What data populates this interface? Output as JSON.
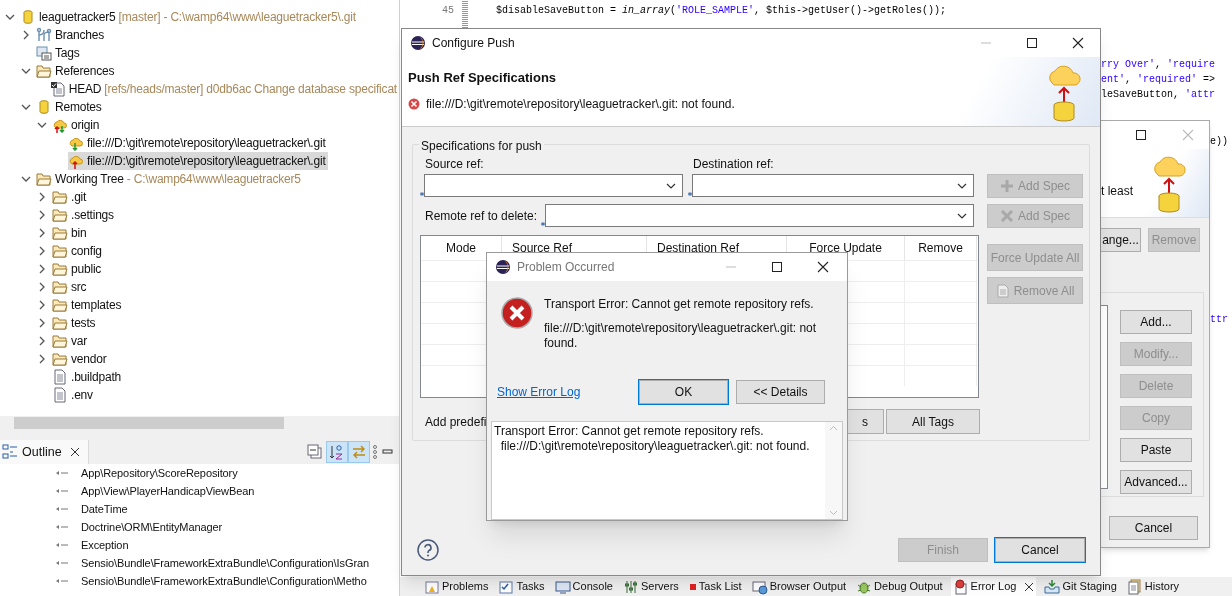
{
  "repositories": {
    "tree": [
      {
        "kind": "repo",
        "label": "leaguetracker5",
        "detail": "[master] - C:\\wamp64\\www\\leaguetracker5\\.git",
        "expanded": true,
        "selected": false,
        "children": [
          {
            "kind": "branches",
            "label": "Branches",
            "expanded": false,
            "selected": false
          },
          {
            "kind": "tags",
            "label": "Tags",
            "selected": false
          },
          {
            "kind": "folder",
            "label": "References",
            "expanded": true,
            "selected": false,
            "children": [
              {
                "kind": "ref",
                "label": "HEAD",
                "detail": "[refs/heads/master] d0db6ac Change database specificat",
                "selected": false
              }
            ]
          },
          {
            "kind": "repo",
            "label": "Remotes",
            "expanded": true,
            "selected": false,
            "children": [
              {
                "kind": "origin",
                "label": "origin",
                "expanded": true,
                "selected": false,
                "children": [
                  {
                    "kind": "fetch",
                    "label": "file:///D:\\git\\remote\\repository\\leaguetracker\\.git",
                    "selected": false
                  },
                  {
                    "kind": "push",
                    "label": "file:///D:\\git\\remote\\repository\\leaguetracker\\.git",
                    "selected": true
                  }
                ]
              }
            ]
          },
          {
            "kind": "folder",
            "label": "Working Tree",
            "detail": "- C:\\wamp64\\www\\leaguetracker5",
            "expanded": true,
            "selected": false,
            "children": [
              {
                "kind": "folder",
                "label": ".git",
                "expanded": false,
                "selected": false
              },
              {
                "kind": "folder",
                "label": ".settings",
                "expanded": false,
                "selected": false
              },
              {
                "kind": "folder",
                "label": "bin",
                "expanded": false,
                "selected": false
              },
              {
                "kind": "folder",
                "label": "config",
                "expanded": false,
                "selected": false
              },
              {
                "kind": "folder",
                "label": "public",
                "expanded": false,
                "selected": false
              },
              {
                "kind": "folder",
                "label": "src",
                "expanded": false,
                "selected": false
              },
              {
                "kind": "folder",
                "label": "templates",
                "expanded": false,
                "selected": false
              },
              {
                "kind": "folder",
                "label": "tests",
                "expanded": false,
                "selected": false
              },
              {
                "kind": "folder",
                "label": "var",
                "expanded": false,
                "selected": false
              },
              {
                "kind": "folder",
                "label": "vendor",
                "expanded": false,
                "selected": false
              },
              {
                "kind": "file",
                "label": ".buildpath",
                "selected": false
              },
              {
                "kind": "file",
                "label": ".env",
                "selected": false
              }
            ]
          }
        ]
      }
    ]
  },
  "outline": {
    "title": "Outline",
    "toolbar": [
      {
        "kind": "collapse",
        "active": false
      },
      {
        "kind": "sort",
        "active": true
      },
      {
        "kind": "link",
        "active": true
      }
    ],
    "items": [
      "App\\Repository\\ScoreRepository",
      "App\\View\\PlayerHandicapViewBean",
      "DateTime",
      "Doctrine\\ORM\\EntityManager",
      "Exception",
      "Sensio\\Bundle\\FrameworkExtraBundle\\Configuration\\IsGran",
      "Sensio\\Bundle\\FrameworkExtraBundle\\Configuration\\Metho"
    ]
  },
  "editor": {
    "lines": [
      {
        "number": "45",
        "segments": [
          {
            "kind": "plain",
            "text": "$disableSaveButton = "
          },
          {
            "kind": "func",
            "text": "in_array"
          },
          {
            "kind": "plain",
            "text": "("
          },
          {
            "kind": "string",
            "text": "'ROLE_SAMPLE'"
          },
          {
            "kind": "plain",
            "text": ", $this->getUser()->getRoles());"
          }
        ]
      }
    ],
    "fragments": [
      [
        {
          "kind": "string",
          "text": "rry Over'"
        },
        {
          "kind": "plain",
          "text": ", "
        },
        {
          "kind": "string",
          "text": "'require"
        }
      ],
      [
        {
          "kind": "string",
          "text": "ent'"
        },
        {
          "kind": "plain",
          "text": ", "
        },
        {
          "kind": "string",
          "text": "'required'"
        },
        {
          "kind": "plain",
          "text": " =>"
        }
      ],
      [
        {
          "kind": "plain",
          "text": "leSaveButton, "
        },
        {
          "kind": "string",
          "text": "'attr"
        }
      ],
      [
        {
          "kind": "plain",
          "text": "e))"
        }
      ],
      [
        {
          "kind": "string",
          "text": "ttr"
        }
      ]
    ]
  },
  "bottom_tabs": [
    {
      "kind": "problems",
      "label": "Problems",
      "selected": false
    },
    {
      "kind": "tasks",
      "label": "Tasks",
      "selected": false
    },
    {
      "kind": "console",
      "label": "Console",
      "selected": false
    },
    {
      "kind": "servers",
      "label": "Servers",
      "selected": false
    },
    {
      "kind": "tasklist",
      "label": "Task List",
      "selected": false
    },
    {
      "kind": "browser",
      "label": "Browser Output",
      "selected": false
    },
    {
      "kind": "debug",
      "label": "Debug Output",
      "selected": false
    },
    {
      "kind": "errorlog",
      "label": "Error Log",
      "selected": true
    },
    {
      "kind": "staging",
      "label": "Git Staging",
      "selected": false
    },
    {
      "kind": "history",
      "label": "History",
      "selected": false
    }
  ],
  "back_dialog": {
    "header_text": "t least",
    "top_buttons": [
      {
        "label": "ange...",
        "disabled": false
      },
      {
        "label": "Remove",
        "disabled": true
      }
    ],
    "side_buttons": [
      {
        "label": "Add...",
        "disabled": false
      },
      {
        "label": "Modify...",
        "disabled": true
      },
      {
        "label": "Delete",
        "disabled": true
      },
      {
        "label": "Copy",
        "disabled": true
      },
      {
        "label": "Paste",
        "disabled": false
      },
      {
        "label": "Advanced...",
        "disabled": false
      }
    ],
    "cancel": "Cancel"
  },
  "configure_push": {
    "title": "Configure Push",
    "header_title": "Push Ref Specifications",
    "error_message": "file:///D:\\git\\remote\\repository\\leaguetracker\\.git: not found.",
    "group_title": "Specifications for push",
    "source_label": "Source ref:",
    "destination_label": "Destination ref:",
    "delete_label": "Remote ref to delete:",
    "spec_buttons": [
      {
        "kind": "plus",
        "label": "Add Spec",
        "disabled": true
      },
      {
        "kind": "cross",
        "label": "Add Spec",
        "disabled": true
      }
    ],
    "table_buttons": [
      {
        "kind": "plain",
        "label": "Force Update All",
        "disabled": true
      },
      {
        "kind": "doc",
        "label": "Remove All",
        "disabled": true
      }
    ],
    "columns": [
      "Mode",
      "Source Ref",
      "Destination Ref",
      "Force Update",
      "Remove"
    ],
    "predefined_label": "Add predefi",
    "predefined_buttons": [
      "s",
      "All Tags"
    ],
    "footer_buttons": [
      {
        "label": "Finish",
        "disabled": true,
        "default": false
      },
      {
        "label": "Cancel",
        "disabled": false,
        "default": true
      }
    ]
  },
  "problem_dialog": {
    "title": "Problem Occurred",
    "message": "Transport Error: Cannot get remote repository refs.",
    "detail": "file:///D:\\git\\remote\\repository\\leaguetracker\\.git: not found.",
    "link": "Show Error Log",
    "buttons": [
      {
        "label": "OK",
        "default": true
      },
      {
        "label": "<< Details",
        "default": false
      }
    ],
    "details_text": "Transport Error: Cannot get remote repository refs.\n  file:///D:\\git\\remote\\repository\\leaguetracker\\.git: not found."
  }
}
